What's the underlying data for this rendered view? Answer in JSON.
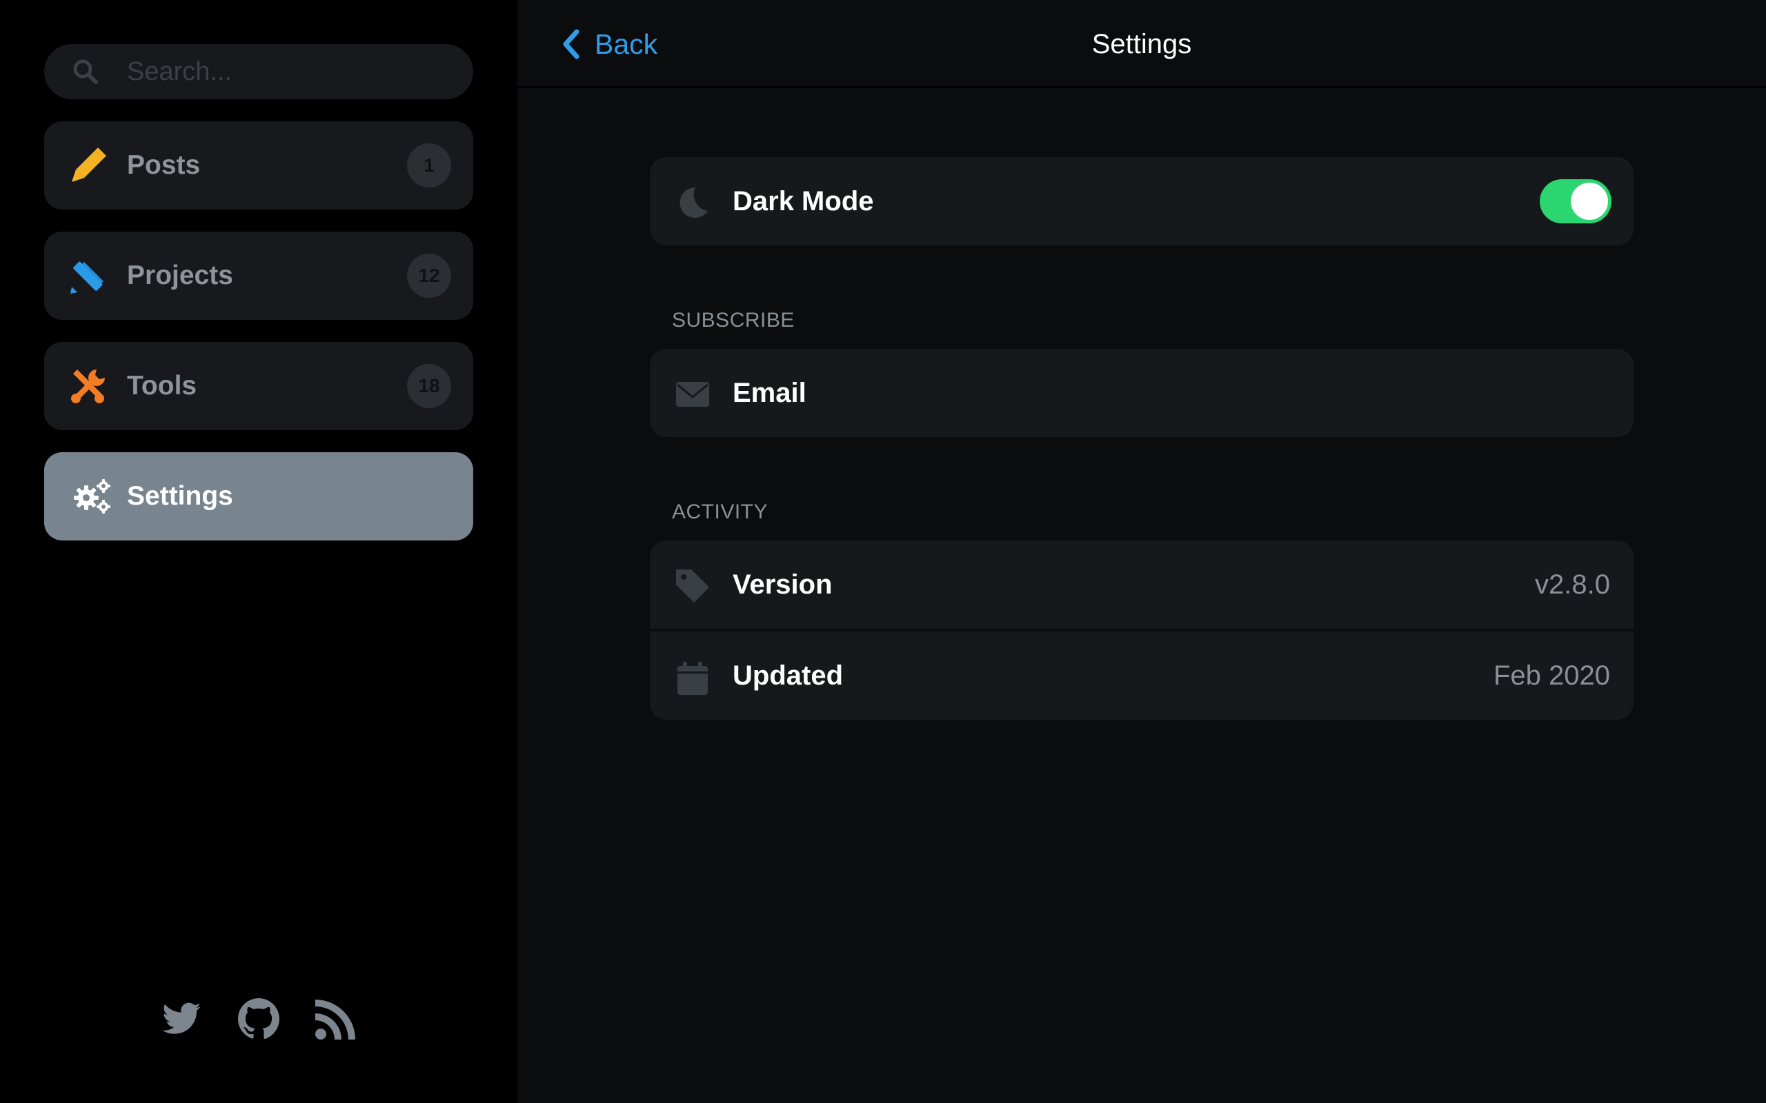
{
  "sidebar": {
    "search": {
      "placeholder": "Search...",
      "icon": "search-icon"
    },
    "items": [
      {
        "label": "Posts",
        "count": "1",
        "icon": "pencil-icon",
        "icon_color": "#f5b324",
        "active": false
      },
      {
        "label": "Projects",
        "count": "12",
        "icon": "pencil-ruler-icon",
        "icon_color": "#2a9be8",
        "active": false
      },
      {
        "label": "Tools",
        "count": "18",
        "icon": "tools-icon",
        "icon_color": "#f27d24",
        "active": false
      },
      {
        "label": "Settings",
        "count": "",
        "icon": "gears-icon",
        "icon_color": "#ffffff",
        "active": true
      }
    ],
    "social": [
      {
        "icon": "twitter-icon"
      },
      {
        "icon": "github-icon"
      },
      {
        "icon": "rss-icon"
      }
    ]
  },
  "header": {
    "back_label": "Back",
    "title": "Settings"
  },
  "settings": {
    "dark_mode": {
      "label": "Dark Mode",
      "icon": "moon-icon",
      "enabled": true
    },
    "subscribe": {
      "header": "SUBSCRIBE",
      "email": {
        "label": "Email",
        "icon": "envelope-icon"
      }
    },
    "activity": {
      "header": "ACTIVITY",
      "version": {
        "label": "Version",
        "value": "v2.8.0",
        "icon": "tag-icon"
      },
      "updated": {
        "label": "Updated",
        "value": "Feb 2020",
        "icon": "calendar-icon"
      }
    }
  },
  "colors": {
    "accent": "#2f9ee8",
    "toggle_on": "#2bd56f",
    "active_nav": "#78858e"
  }
}
